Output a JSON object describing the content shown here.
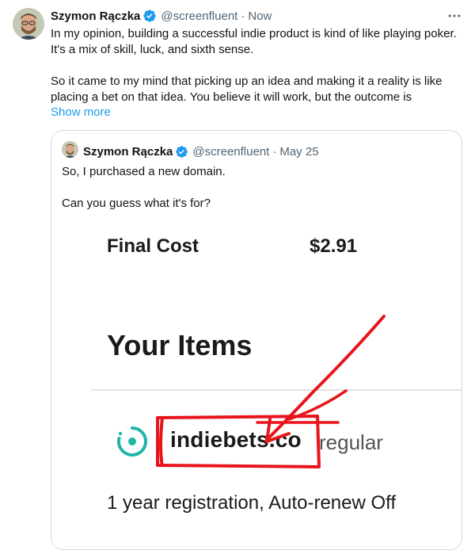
{
  "tweet": {
    "author_name": "Szymon Rączka",
    "author_handle": "@screenfluent",
    "separator": "·",
    "time": "Now",
    "text": "In my opinion, building a successful indie product is kind of like playing poker. It's a mix of skill, luck, and sixth sense.\n\nSo it came to my mind that picking up an idea and making it a reality is like placing a bet on that idea. You believe it will work, but the outcome is",
    "show_more_label": "Show more",
    "more_icon": "more-horizontal-icon",
    "verified_icon": "verified-badge-icon"
  },
  "quoted_tweet": {
    "author_name": "Szymon Rączka",
    "author_handle": "@screenfluent",
    "separator": "·",
    "time": "May 25",
    "text": "So, I purchased a new domain.\n\nCan you guess what it's for?",
    "image": {
      "final_cost_label": "Final Cost",
      "final_cost_value": "$2.91",
      "items_heading": "Your Items",
      "domain_name": "indiebets.co",
      "domain_tier": "regular",
      "registration_info": "1 year registration, Auto-renew Off",
      "domain_icon": "ring-logo-icon",
      "ring_color": "#1fb5a8",
      "annotation_color": "#e8141c"
    }
  }
}
